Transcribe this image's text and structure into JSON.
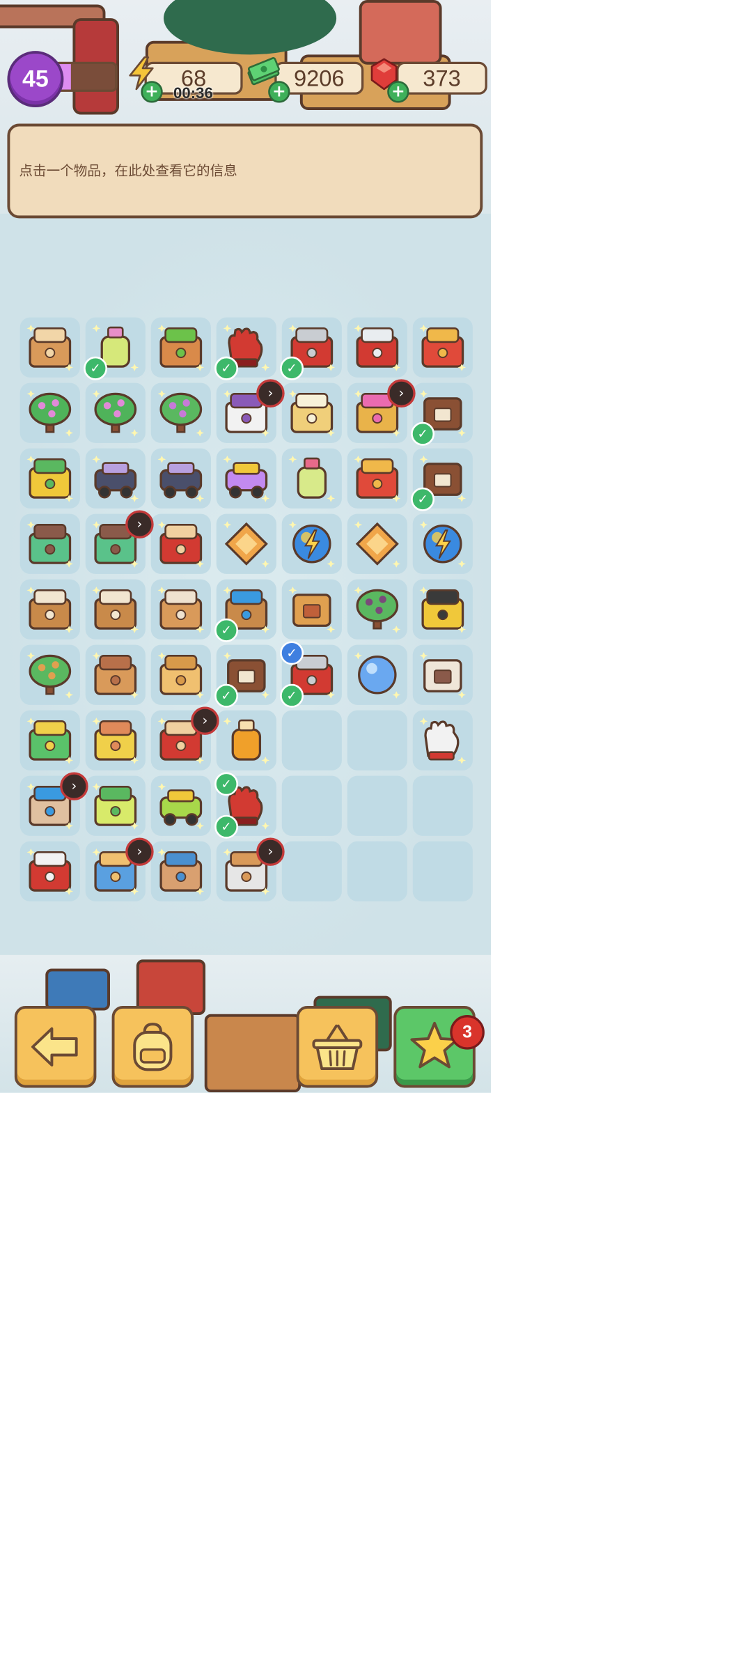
{
  "hud": {
    "level": "45",
    "xp_progress": 0.25,
    "energy": "68",
    "energy_timer": "00:36",
    "cash": "9206",
    "gems": "373"
  },
  "info_panel": {
    "text": "点击一个物品，在此处查看它的信息"
  },
  "colors": {
    "panel_bg": "#f1dcbc",
    "panel_border": "#6b4a34",
    "cell_bg": "#c0dbe5",
    "check_green": "#3db86a",
    "level_purple": "#9b48c9"
  },
  "grid": {
    "cols": 7,
    "rows": 9,
    "items": [
      [
        "box-items-icon",
        "flask-icon",
        "seedling-pot-icon",
        "red-gloves-icon",
        "hand-saw-icon",
        "saw-blade-icon",
        "dragon-statue-icon"
      ],
      [
        "flower-tree-icon",
        "flower-tree-icon",
        "flower-bush-icon",
        "white-flowers-icon",
        "lamp-box-icon",
        "flower-basket-icon",
        "leather-bag-icon"
      ],
      [
        "bucket-icon",
        "jeep-icon",
        "jeep-icon",
        "helicopter-icon",
        "spray-bottle-icon",
        "dragon-statue-icon",
        "leather-bag-icon"
      ],
      [
        "first-aid-kit-icon",
        "first-aid-kit-icon",
        "red-toolbox-icon",
        "amber-tile-icon",
        "energy-orb-icon",
        "amber-tile-icon",
        "energy-orb-icon"
      ],
      [
        "wooden-crate-icon",
        "wooden-crate-icon",
        "clay-pot-crate-icon",
        "binoculars-icon",
        "brown-wallet-icon",
        "bonsai-icon",
        "barrier-icon"
      ],
      [
        "potted-plant-icon",
        "wooden-planks-icon",
        "bread-icon",
        "leather-bag-icon",
        "hammer-icon",
        "blue-bead-icon",
        "seed-packet-icon"
      ],
      [
        "green-chest-icon",
        "yellow-flower-pot-icon",
        "robot-machine-icon",
        "honey-jar-icon",
        "",
        "",
        "white-glove-icon"
      ],
      [
        "detective-kit-icon",
        "green-machine-icon",
        "green-cart-icon",
        "red-gloves-icon",
        "",
        "",
        ""
      ],
      [
        "red-chest-icon",
        "box-stack-icon",
        "safe-box-icon",
        "map-scroll-icon",
        "",
        "",
        ""
      ]
    ],
    "badges": [
      {
        "row": 0,
        "col": 1,
        "type": "check"
      },
      {
        "row": 0,
        "col": 3,
        "type": "check"
      },
      {
        "row": 0,
        "col": 3,
        "type": "check-bottom"
      },
      {
        "row": 0,
        "col": 4,
        "type": "check"
      },
      {
        "row": 1,
        "col": 3,
        "type": "arrow"
      },
      {
        "row": 1,
        "col": 5,
        "type": "arrow"
      },
      {
        "row": 1,
        "col": 6,
        "type": "check"
      },
      {
        "row": 2,
        "col": 6,
        "type": "check"
      },
      {
        "row": 3,
        "col": 1,
        "type": "arrow"
      },
      {
        "row": 4,
        "col": 3,
        "type": "check"
      },
      {
        "row": 5,
        "col": 3,
        "type": "check"
      },
      {
        "row": 5,
        "col": 4,
        "type": "check-blue"
      },
      {
        "row": 5,
        "col": 4,
        "type": "check"
      },
      {
        "row": 6,
        "col": 2,
        "type": "arrow"
      },
      {
        "row": 7,
        "col": 0,
        "type": "arrow"
      },
      {
        "row": 7,
        "col": 3,
        "type": "check-top"
      },
      {
        "row": 7,
        "col": 3,
        "type": "check"
      },
      {
        "row": 8,
        "col": 1,
        "type": "arrow"
      },
      {
        "row": 8,
        "col": 3,
        "type": "arrow"
      }
    ]
  },
  "buttons": {
    "back": "back-arrow-icon",
    "backpack": "backpack-icon",
    "basket": "basket-icon",
    "star": "star-icon",
    "star_count": "3"
  }
}
